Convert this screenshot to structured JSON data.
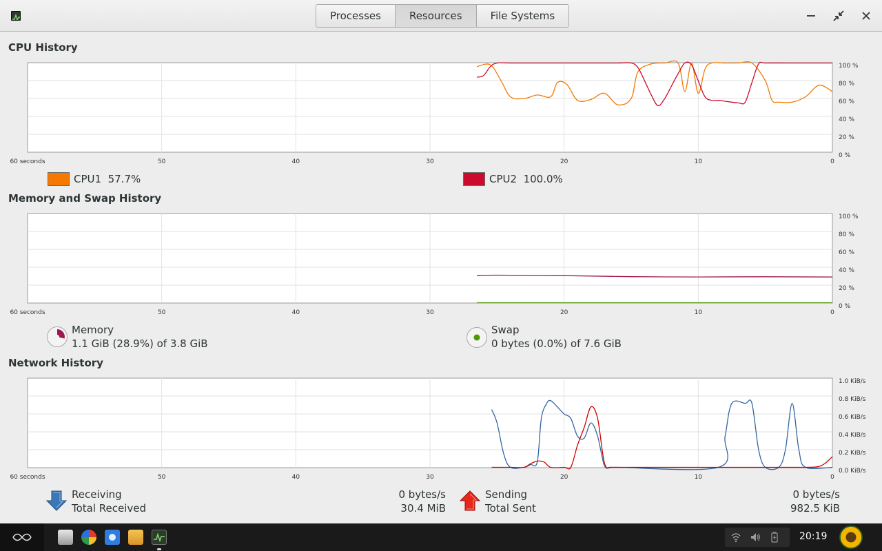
{
  "window": {
    "tabs": [
      {
        "label": "Processes",
        "active": false
      },
      {
        "label": "Resources",
        "active": true
      },
      {
        "label": "File Systems",
        "active": false
      }
    ]
  },
  "time_axis": [
    "60 seconds",
    "50",
    "40",
    "30",
    "20",
    "10",
    "0"
  ],
  "cpu": {
    "title": "CPU History",
    "y_ticks": [
      "100 %",
      "80 %",
      "60 %",
      "40 %",
      "20 %",
      "0 %"
    ],
    "legend": [
      {
        "name": "CPU1",
        "value": "57.7%",
        "color": "#f57900"
      },
      {
        "name": "CPU2",
        "value": "100.0%",
        "color": "#cc0a2d"
      }
    ]
  },
  "memory": {
    "title": "Memory and Swap History",
    "y_ticks": [
      "100 %",
      "80 %",
      "60 %",
      "40 %",
      "20 %",
      "0 %"
    ],
    "memory_label": "Memory",
    "memory_detail": "1.1 GiB (28.9%) of 3.8 GiB",
    "memory_color": "#a0164f",
    "memory_fraction": 0.289,
    "swap_label": "Swap",
    "swap_detail": "0 bytes (0.0%) of 7.6 GiB",
    "swap_color": "#4e9a06",
    "swap_fraction": 0.0
  },
  "network": {
    "title": "Network History",
    "y_ticks": [
      "1.0 KiB/s",
      "0.8 KiB/s",
      "0.6 KiB/s",
      "0.4 KiB/s",
      "0.2 KiB/s",
      "0.0 KiB/s"
    ],
    "receiving_label": "Receiving",
    "receiving_rate": "0 bytes/s",
    "total_received_label": "Total Received",
    "total_received": "30.4 MiB",
    "receiving_color": "#3465a4",
    "sending_label": "Sending",
    "sending_rate": "0 bytes/s",
    "total_sent_label": "Total Sent",
    "total_sent": "982.5 KiB",
    "sending_color": "#cc0000"
  },
  "chart_data": [
    {
      "type": "line",
      "title": "CPU History",
      "xlabel": "",
      "ylabel": "",
      "xlim": [
        60,
        0
      ],
      "ylim": [
        0,
        100
      ],
      "series": [
        {
          "name": "CPU1",
          "x": [
            26.5,
            25.5,
            24.7,
            24,
            23,
            22,
            21,
            20.5,
            19.8,
            19,
            18,
            17,
            16,
            15,
            14.5,
            13.5,
            12.5,
            11.5,
            11,
            10.5,
            10,
            9.5,
            9,
            8,
            7,
            6,
            5,
            4.5,
            4,
            3,
            2,
            1,
            0
          ],
          "values": [
            96,
            98,
            80,
            62,
            60,
            64,
            62,
            78,
            76,
            58,
            59,
            66,
            53,
            60,
            90,
            99,
            100,
            100,
            68,
            100,
            66,
            93,
            100,
            100,
            100,
            100,
            80,
            58,
            56,
            56,
            62,
            75,
            68
          ]
        },
        {
          "name": "CPU2",
          "x": [
            26.5,
            26,
            25.5,
            25,
            24,
            22,
            20,
            18,
            16,
            15,
            14.5,
            14,
            13.5,
            13,
            12.5,
            12,
            11.5,
            11,
            10.5,
            10,
            9.5,
            9,
            8.5,
            8,
            7,
            6.5,
            6,
            5.5,
            5,
            3,
            0
          ],
          "values": [
            84,
            86,
            96,
            100,
            100,
            100,
            100,
            100,
            100,
            100,
            95,
            80,
            64,
            52,
            60,
            74,
            88,
            100,
            98,
            80,
            62,
            58,
            58,
            57,
            55,
            56,
            78,
            99,
            100,
            100,
            100
          ]
        }
      ]
    },
    {
      "type": "line",
      "title": "Memory and Swap History",
      "xlabel": "",
      "ylabel": "",
      "xlim": [
        60,
        0
      ],
      "ylim": [
        0,
        100
      ],
      "series": [
        {
          "name": "Memory",
          "x": [
            26.5,
            25,
            20,
            15,
            10,
            5,
            0
          ],
          "values": [
            30.5,
            31.0,
            30.5,
            29.3,
            29.0,
            29.2,
            28.9
          ]
        },
        {
          "name": "Swap",
          "x": [
            26.5,
            0
          ],
          "values": [
            0.0,
            0.0
          ]
        }
      ]
    },
    {
      "type": "line",
      "title": "Network History",
      "xlabel": "",
      "ylabel": "",
      "xlim": [
        60,
        0
      ],
      "ylim": [
        0,
        1.0
      ],
      "series": [
        {
          "name": "Receiving",
          "x": [
            25.4,
            25,
            24.5,
            24,
            23,
            22.5,
            22,
            21.7,
            21.3,
            21,
            20.5,
            20,
            19.5,
            19,
            18.5,
            18,
            17.5,
            17,
            16.5,
            16,
            8.5,
            8,
            7.5,
            6.5,
            6,
            5.5,
            5,
            4,
            3.5,
            3,
            2.5,
            2,
            0
          ],
          "values": [
            0.65,
            0.5,
            0.15,
            0.0,
            0.0,
            0.03,
            0.06,
            0.55,
            0.72,
            0.75,
            0.68,
            0.6,
            0.55,
            0.35,
            0.33,
            0.5,
            0.35,
            0.02,
            0.0,
            0.0,
            0.0,
            0.35,
            0.72,
            0.72,
            0.72,
            0.2,
            0.0,
            0.0,
            0.2,
            0.72,
            0.2,
            0.0,
            0.0
          ]
        },
        {
          "name": "Sending",
          "x": [
            25.4,
            24,
            23,
            22.5,
            22,
            21.5,
            21,
            20,
            19.5,
            19,
            18.5,
            18,
            17.5,
            17,
            16.5,
            16,
            10,
            5,
            2,
            1,
            0.5,
            0
          ],
          "values": [
            0.0,
            0.0,
            0.0,
            0.04,
            0.07,
            0.06,
            0.0,
            0.0,
            0.0,
            0.25,
            0.45,
            0.68,
            0.55,
            0.05,
            0.0,
            0.0,
            0.0,
            0.0,
            0.0,
            0.01,
            0.05,
            0.12
          ]
        }
      ]
    }
  ],
  "taskbar": {
    "clock": "20:19",
    "apps": [
      "disk-utility-icon",
      "software-center-icon",
      "browser-icon",
      "files-icon",
      "system-monitor-icon"
    ]
  }
}
